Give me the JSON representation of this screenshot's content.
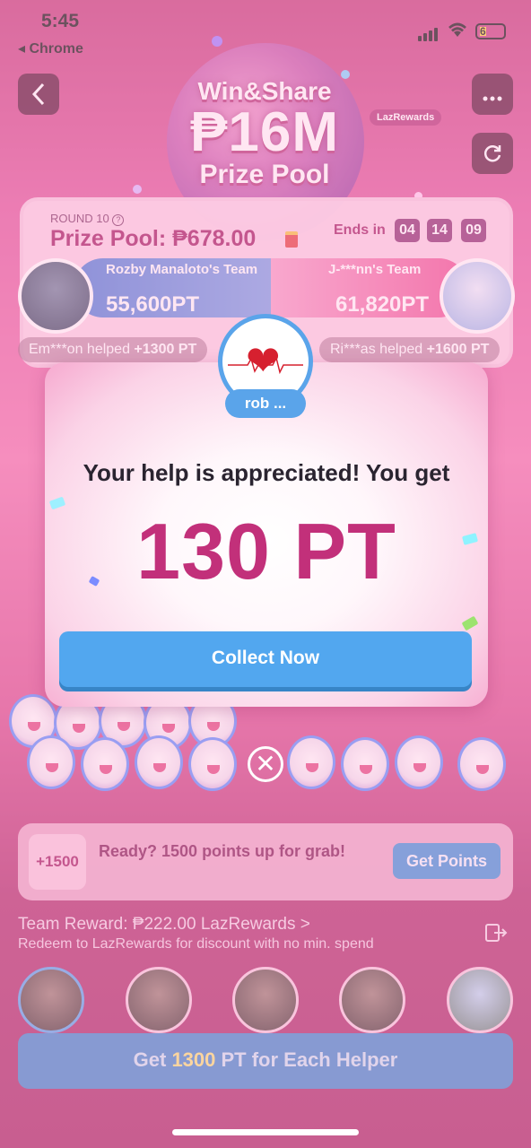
{
  "status_bar": {
    "time": "5:45",
    "back_app": "◂ Chrome",
    "battery": "6"
  },
  "header": {
    "title_line1": "Win&Share",
    "title_line2": "₱16M",
    "title_line3": "Prize Pool",
    "brand_tag": "LazRewards"
  },
  "round": {
    "label": "ROUND 10",
    "prize_pool": "Prize Pool: ₱678.00",
    "ends_in_label": "Ends in",
    "timer": [
      "04",
      "14",
      "09"
    ]
  },
  "teams": {
    "left_name": "Rozby Manaloto's Team",
    "left_points": "55,600PT",
    "right_name": "J-***nn's Team",
    "right_points": "61,820PT",
    "left_helped_name": "Em***on helped ",
    "left_helped_pts": "+1300 PT",
    "right_helped_name": "Ri***as helped ",
    "right_helped_pts": "+1600 PT"
  },
  "modal": {
    "user_name": "rob ...",
    "message": "Your help is appreciated! You get",
    "points": "130 PT",
    "collect_label": "Collect Now",
    "close_symbol": "✕"
  },
  "points_card": {
    "plus_value": "+1500",
    "text": "Ready? 1500 points up for grab!",
    "button_label": "Get Points"
  },
  "team_reward": {
    "text": "Team Reward: ₱222.00 ",
    "link": "LazRewards >",
    "subtext": "Redeem to LazRewards for discount with no min. spend"
  },
  "cta": {
    "prefix": "Get ",
    "highlight": "1300",
    "suffix": " PT for Each Helper"
  },
  "icons": {
    "back": "chevron-left-icon",
    "more": "more-icon",
    "refresh": "refresh-icon",
    "heart": "heart-icon",
    "close": "close-icon",
    "exit": "exit-icon"
  },
  "colors": {
    "accent_pink": "#c2307a",
    "button_blue": "#52a7ef",
    "cta_blue": "#3e85cc",
    "badge_blue": "#5aa4ea"
  }
}
